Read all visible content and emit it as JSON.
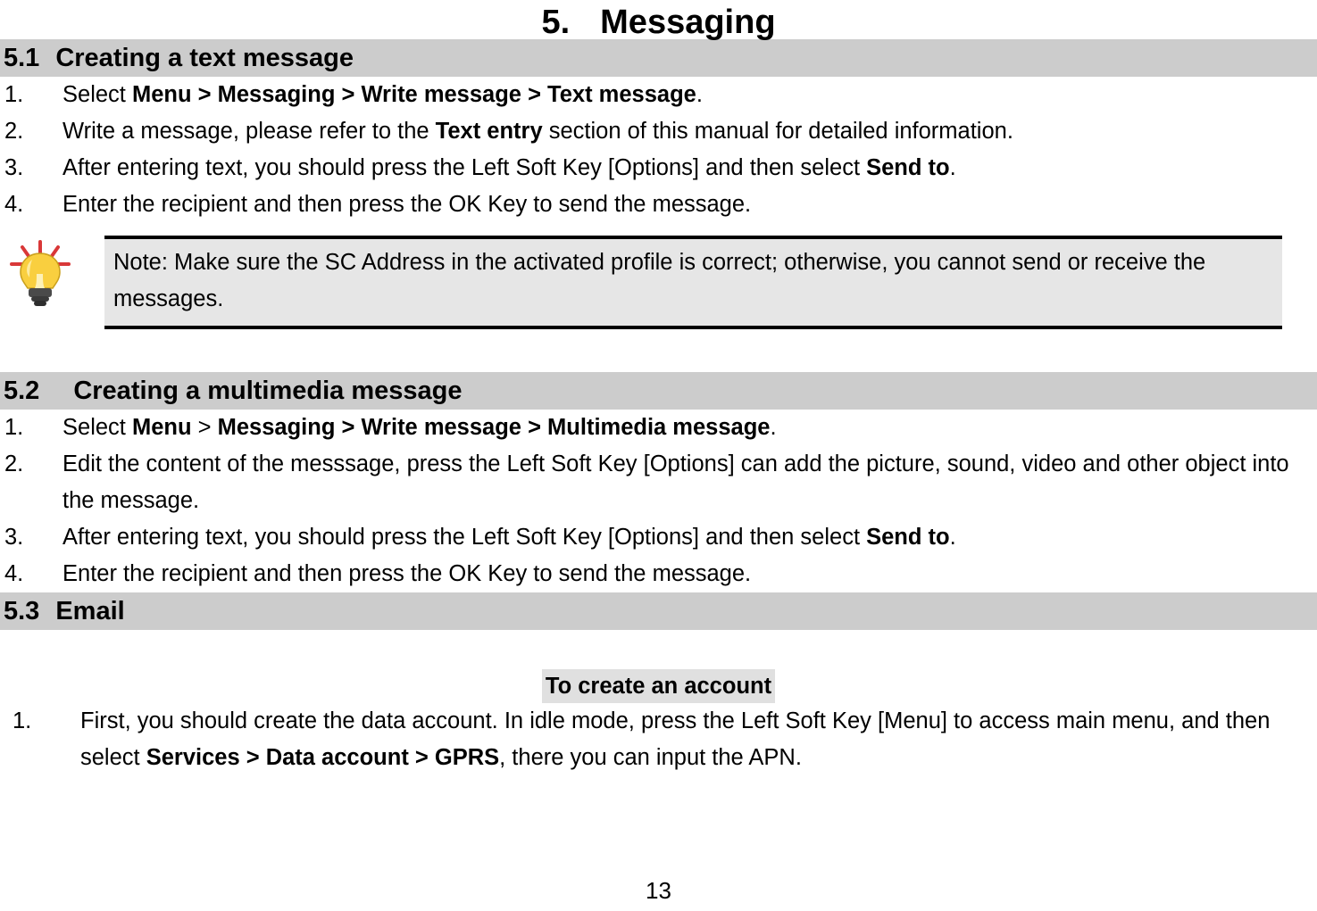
{
  "document": {
    "chapter_number": "5.",
    "chapter_title": "Messaging",
    "page_number": "13"
  },
  "sections": [
    {
      "id": "5.1",
      "number": "5.1",
      "title": "Creating a text message",
      "items": [
        {
          "marker": "1.",
          "pre": "Select ",
          "bold1": "Menu > Messaging > Write message > Text message",
          "post": "."
        },
        {
          "marker": "2.",
          "pre": "Write a message, please refer to the ",
          "bold1": "Text entry",
          "post": " section of this manual for detailed information."
        },
        {
          "marker": "3.",
          "pre": "After entering text, you should press the Left Soft Key [Options] and then select ",
          "bold1": "Send to",
          "post": "."
        },
        {
          "marker": "4.",
          "pre": "Enter the recipient and then press the OK Key to send the message.",
          "bold1": "",
          "post": ""
        }
      ]
    },
    {
      "id": "5.2",
      "number": "5.2",
      "title": "Creating a multimedia message",
      "items": [
        {
          "marker": "1.",
          "pre": "Select ",
          "bold1": "Menu",
          "mid": " > ",
          "bold2": "Messaging > Write message > Multimedia message",
          "post": "."
        },
        {
          "marker": "2.",
          "pre": "Edit the content of the messsage, press the Left Soft Key [Options] can add the picture, sound, video and other object into the message.",
          "bold1": "",
          "post": ""
        },
        {
          "marker": "3.",
          "pre": "After entering text, you should press the Left Soft Key [Options] and then select ",
          "bold1": "Send to",
          "post": "."
        },
        {
          "marker": "4.",
          "pre": "Enter the recipient and then press the OK Key to send the message.",
          "bold1": "",
          "post": ""
        }
      ]
    },
    {
      "id": "5.3",
      "number": "5.3",
      "title": "Email",
      "subheading": "To create an account",
      "items": [
        {
          "marker": "1.",
          "pre": "First, you should create the data account. In idle mode, press the Left Soft Key [Menu] to access main menu, and then select ",
          "bold1": "Services > Data account > GPRS",
          "post": ", there you can input the APN."
        }
      ]
    }
  ],
  "note": {
    "icon": "lightbulb-tip-icon",
    "text": "Note: Make sure the SC Address in the activated profile is correct; otherwise, you cannot send or receive the messages."
  },
  "colors": {
    "section_bar_bg": "#cccccc",
    "note_bg": "#e6e6e6",
    "highlight_bg": "#e0e0e0",
    "bulb_yellow": "#ffd24d",
    "bulb_ray_red": "#d93838",
    "bulb_base_gray": "#4a4a4a",
    "text": "#000000"
  }
}
